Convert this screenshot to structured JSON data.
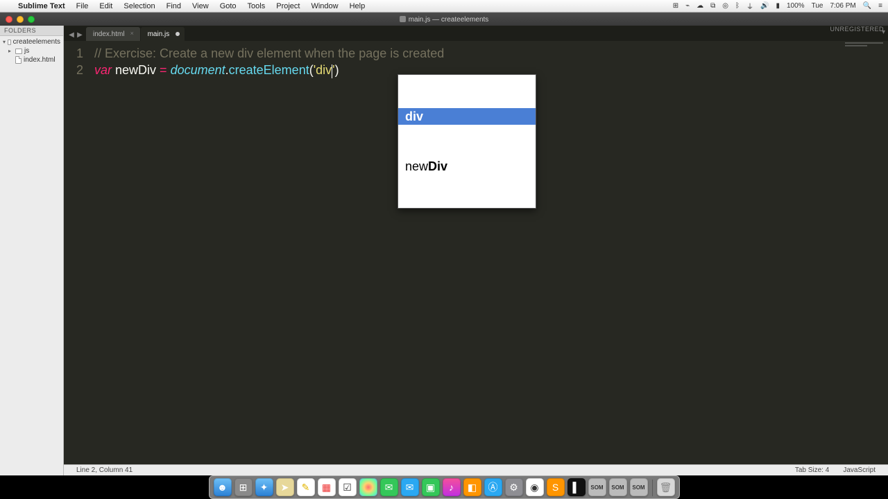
{
  "menubar": {
    "app": "Sublime Text",
    "items": [
      "File",
      "Edit",
      "Selection",
      "Find",
      "View",
      "Goto",
      "Tools",
      "Project",
      "Window",
      "Help"
    ],
    "battery": "100%",
    "day": "Tue",
    "time": "7:06 PM"
  },
  "window": {
    "title": "main.js — createelements",
    "unregistered": "UNREGISTERED"
  },
  "sidebar": {
    "header": "FOLDERS",
    "items": [
      {
        "indent": 0,
        "arrow": "▾",
        "icon": "folder",
        "label": "createelements"
      },
      {
        "indent": 1,
        "arrow": "▸",
        "icon": "folder",
        "label": "js"
      },
      {
        "indent": 1,
        "arrow": "",
        "icon": "file",
        "label": "index.html"
      }
    ]
  },
  "tabs": {
    "inactive": "index.html",
    "active": "main.js"
  },
  "code": {
    "line1_num": "1",
    "line2_num": "2",
    "comment": "// Exercise: Create a new div element when the page is created",
    "kw_var": "var",
    "varname": " newDiv ",
    "op_eq": "= ",
    "doc": "document",
    "dot": ".",
    "fn": "createElement",
    "lp": "(",
    "q1": "'",
    "str": "div",
    "q2": "'",
    "rp": ")"
  },
  "autocomplete": {
    "row1_plain": "",
    "row1_bold": "div",
    "row2_plain": "new",
    "row2_bold": "Div"
  },
  "status": {
    "left": "Line 2, Column 41",
    "tabsize": "Tab Size: 4",
    "lang": "JavaScript"
  },
  "dock": {
    "icons": [
      "finder",
      "launchpad",
      "safari",
      "maps",
      "notes",
      "calendar",
      "reminders",
      "photos",
      "messages",
      "mail",
      "facetime",
      "itunes",
      "ibooks",
      "appstore",
      "preferences",
      "chrome",
      "sublime",
      "terminal",
      "som1",
      "som2",
      "som3",
      "trash"
    ]
  }
}
